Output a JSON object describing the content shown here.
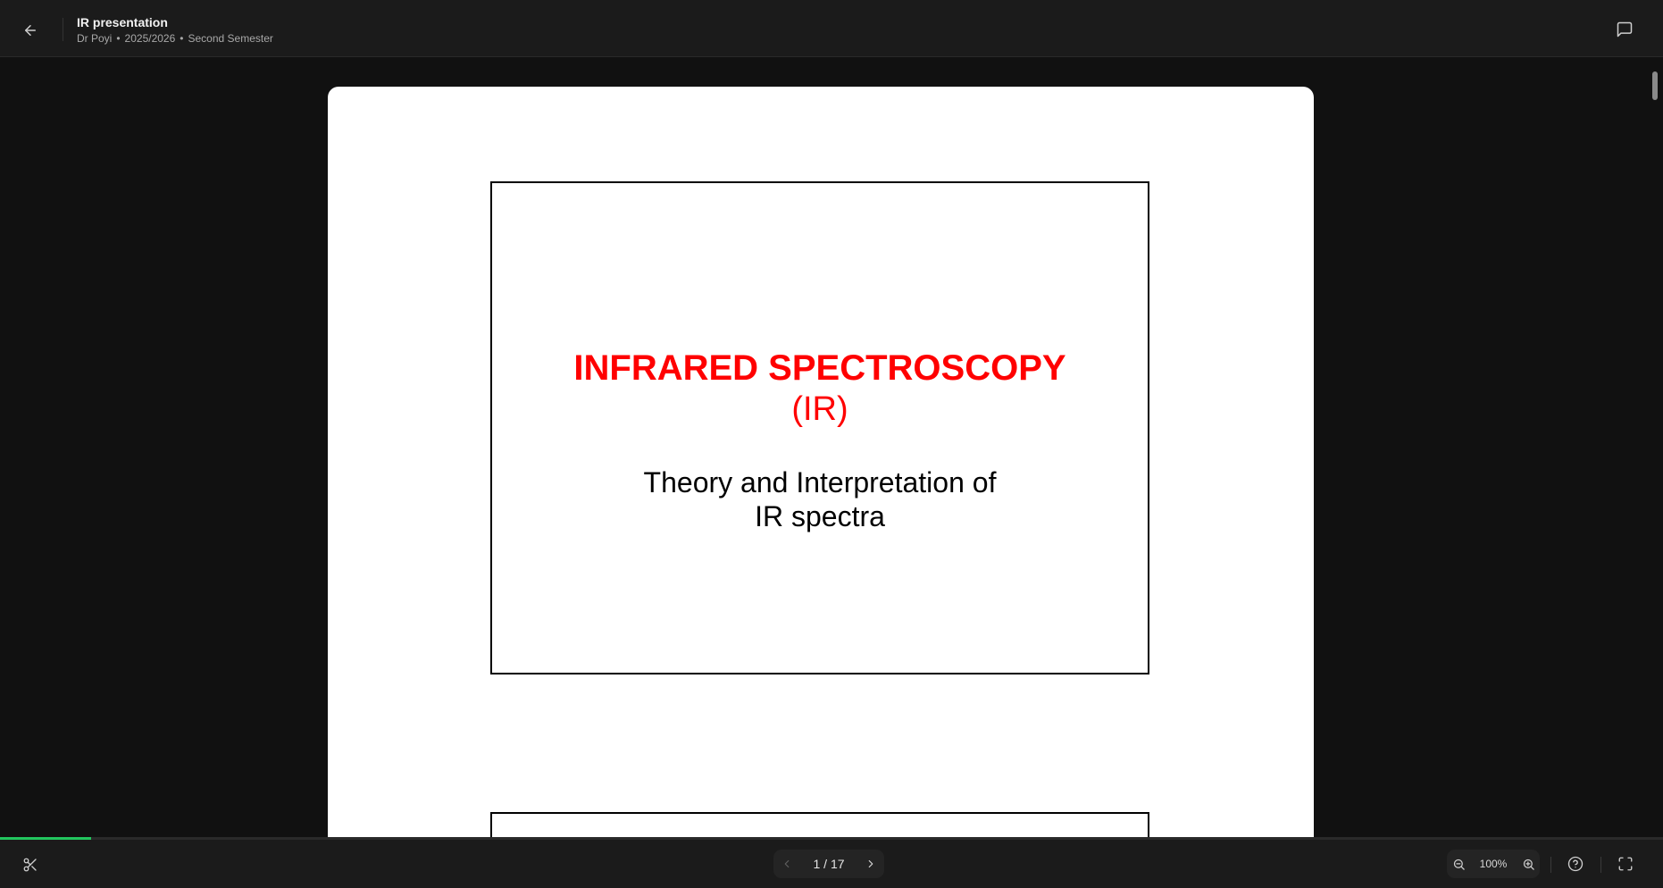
{
  "header": {
    "title": "IR presentation",
    "author": "Dr Poyi",
    "session": "2025/2026",
    "semester": "Second Semester",
    "separator": "•",
    "back_icon": "arrow-left-icon",
    "comments_icon": "message-square-icon"
  },
  "slide": {
    "title": "INFRARED SPECTROSCOPY",
    "abbreviation": "(IR)",
    "subtitle_line1": "Theory and Interpretation of",
    "subtitle_line2": "IR spectra",
    "title_color": "#ff0000"
  },
  "footer": {
    "clip_icon": "scissors-icon",
    "page_indicator": "1 / 17",
    "current_page": 1,
    "total_pages": 17,
    "zoom_label": "100%",
    "progress_percent": 5.5,
    "help_icon": "help-circle-icon",
    "fullscreen_icon": "fullscreen-icon",
    "accent_color": "#22c55e"
  }
}
